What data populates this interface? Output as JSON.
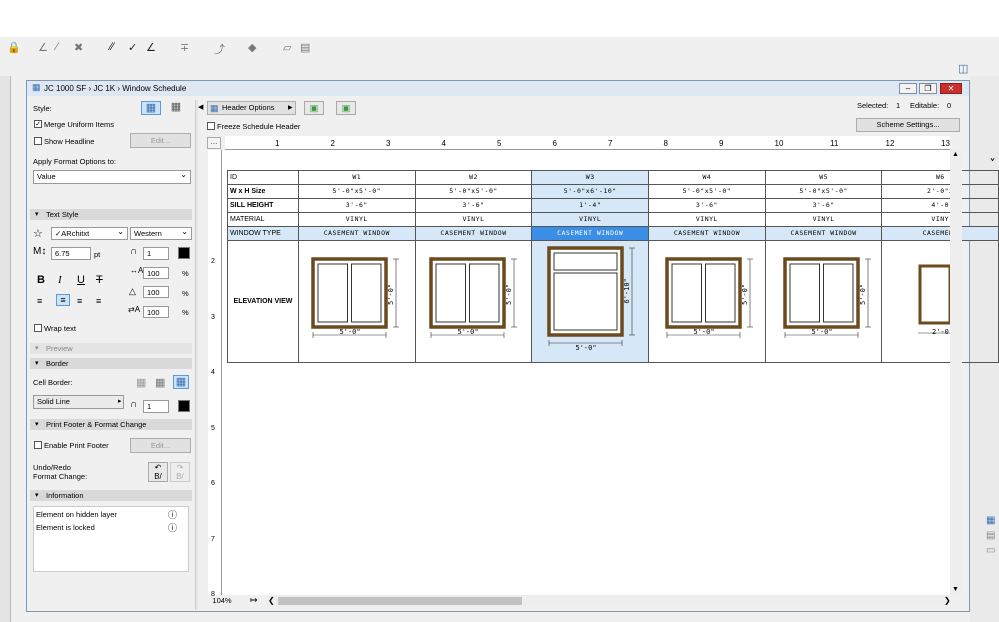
{
  "window": {
    "title": "JC 1000 SF › JC 1K › Window Schedule"
  },
  "panel": {
    "style_label": "Style:",
    "merge_uniform": "Merge Uniform Items",
    "show_headline": "Show Headline",
    "edit1": "Edit...",
    "apply_format": "Apply Format Options to:",
    "apply_value": "Value",
    "text_style": "Text Style",
    "font_name": "✓ARchitxt",
    "script": "Western",
    "size": "6.75",
    "size_unit": "pt",
    "pen": "1",
    "width_pct": "100",
    "height_pct": "100",
    "spacing_pct": "100",
    "pct": "%",
    "wrap_text": "Wrap text",
    "preview": "Preview",
    "border": "Border",
    "cell_border": "Cell Border:",
    "line_type": "Solid Line",
    "border_pen": "1",
    "print_footer": "Print Footer & Format Change",
    "enable_footer": "Enable Print Footer",
    "edit2": "Edit...",
    "undo_redo": "Undo/Redo",
    "format_change": "Format Change:",
    "information": "Information",
    "info_items": [
      "Element on hidden layer",
      "Element is locked"
    ]
  },
  "schedule": {
    "header_options": "Header Options",
    "freeze_header": "Freeze Schedule Header",
    "selected_label": "Selected:",
    "selected_count": "1",
    "editable_label": "Editable:",
    "editable_count": "0",
    "scheme_settings": "Scheme Settings...",
    "zoom": "104%",
    "ruler_ticks": [
      "1",
      "2",
      "3",
      "4",
      "5",
      "6",
      "7",
      "8",
      "9",
      "10",
      "11",
      "12",
      "13"
    ],
    "vruler_ticks": [
      "2",
      "3",
      "4",
      "5",
      "6",
      "7",
      "8"
    ],
    "row_headers": [
      "ID",
      "W x H Size",
      "SILL HEIGHT",
      "MATERIAL",
      "WINDOW TYPE",
      "ELEVATION VIEW"
    ],
    "columns": [
      {
        "id": "W1",
        "size": "5'-0\"x5'-0\"",
        "sill": "3'-6\"",
        "material": "VINYL",
        "type": "CASEMENT WINDOW",
        "dim_w": "5'-0\"",
        "dim_h": "5'-0\""
      },
      {
        "id": "W2",
        "size": "5'-0\"x5'-0\"",
        "sill": "3'-6\"",
        "material": "VINYL",
        "type": "CASEMENT WINDOW",
        "dim_w": "5'-0\"",
        "dim_h": "5'-0\""
      },
      {
        "id": "W3",
        "size": "5'-0\"x6'-10\"",
        "sill": "1'-4\"",
        "material": "VINYL",
        "type": "CASEMENT WINDOW",
        "dim_w": "5'-0\"",
        "dim_h": "6'-10\""
      },
      {
        "id": "W4",
        "size": "5'-0\"x5'-0\"",
        "sill": "3'-6\"",
        "material": "VINYL",
        "type": "CASEMENT WINDOW",
        "dim_w": "5'-0\"",
        "dim_h": "5'-0\""
      },
      {
        "id": "W5",
        "size": "5'-0\"x5'-0\"",
        "sill": "3'-6\"",
        "material": "VINYL",
        "type": "CASEMENT WINDOW",
        "dim_w": "5'-0\"",
        "dim_h": "5'-0\""
      },
      {
        "id": "W6",
        "size": "2'-0\"x",
        "sill": "4'-0",
        "material": "VINY",
        "type": "CASEMENT",
        "dim_w": "2'-0\"",
        "dim_h": ""
      }
    ]
  },
  "colors": {
    "frame": "#6b4a1c",
    "selection": "#3a8ee6",
    "selected_bg": "#d6e8f7"
  }
}
